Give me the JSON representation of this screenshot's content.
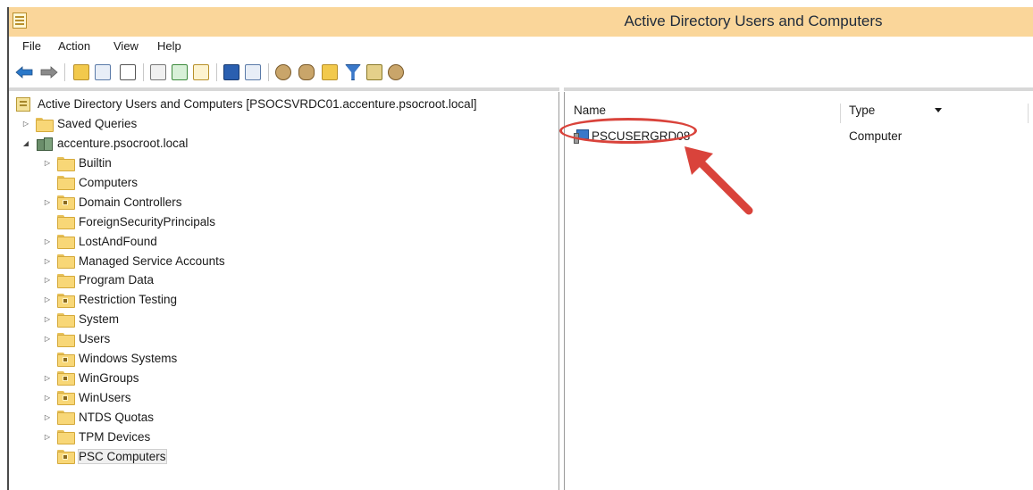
{
  "window": {
    "title": "Active Directory Users and Computers"
  },
  "menu": [
    "File",
    "Action",
    "View",
    "Help"
  ],
  "toolbar": {
    "icons": [
      "back-arrow-icon",
      "forward-arrow-icon",
      "up-level-icon",
      "show-hide-console-tree-icon",
      "properties-clipboard-icon",
      "export-list-icon",
      "refresh-icon",
      "export-icon",
      "help-icon",
      "show-hide-action-pane-icon",
      "create-user-icon",
      "create-group-icon",
      "create-ou-icon",
      "filter-icon",
      "add-to-group-icon",
      "find-icon"
    ]
  },
  "tree": {
    "root": "Active Directory Users and Computers [PSOCSVRDC01.accenture.psocroot.local]",
    "saved_queries": "Saved Queries",
    "domain": "accenture.psocroot.local",
    "items": [
      {
        "label": "Builtin",
        "expandable": true,
        "ou": false
      },
      {
        "label": "Computers",
        "expandable": false,
        "ou": false
      },
      {
        "label": "Domain Controllers",
        "expandable": true,
        "ou": true
      },
      {
        "label": "ForeignSecurityPrincipals",
        "expandable": false,
        "ou": false
      },
      {
        "label": "LostAndFound",
        "expandable": true,
        "ou": false
      },
      {
        "label": "Managed Service Accounts",
        "expandable": true,
        "ou": false
      },
      {
        "label": "Program Data",
        "expandable": true,
        "ou": false
      },
      {
        "label": "Restriction Testing",
        "expandable": true,
        "ou": true
      },
      {
        "label": "System",
        "expandable": true,
        "ou": false
      },
      {
        "label": "Users",
        "expandable": true,
        "ou": false
      },
      {
        "label": "Windows Systems",
        "expandable": false,
        "ou": true
      },
      {
        "label": "WinGroups",
        "expandable": true,
        "ou": true
      },
      {
        "label": "WinUsers",
        "expandable": true,
        "ou": true
      },
      {
        "label": "NTDS Quotas",
        "expandable": true,
        "ou": false
      },
      {
        "label": "TPM Devices",
        "expandable": true,
        "ou": false
      },
      {
        "label": "PSC Computers",
        "expandable": false,
        "ou": true,
        "selected": true
      }
    ]
  },
  "list": {
    "columns": [
      "Name",
      "Type"
    ],
    "rows": [
      {
        "name": "PSCUSERGRD08",
        "type": "Computer"
      }
    ]
  },
  "colors": {
    "titlebar": "#fad69a",
    "annotation": "#d9433b"
  }
}
